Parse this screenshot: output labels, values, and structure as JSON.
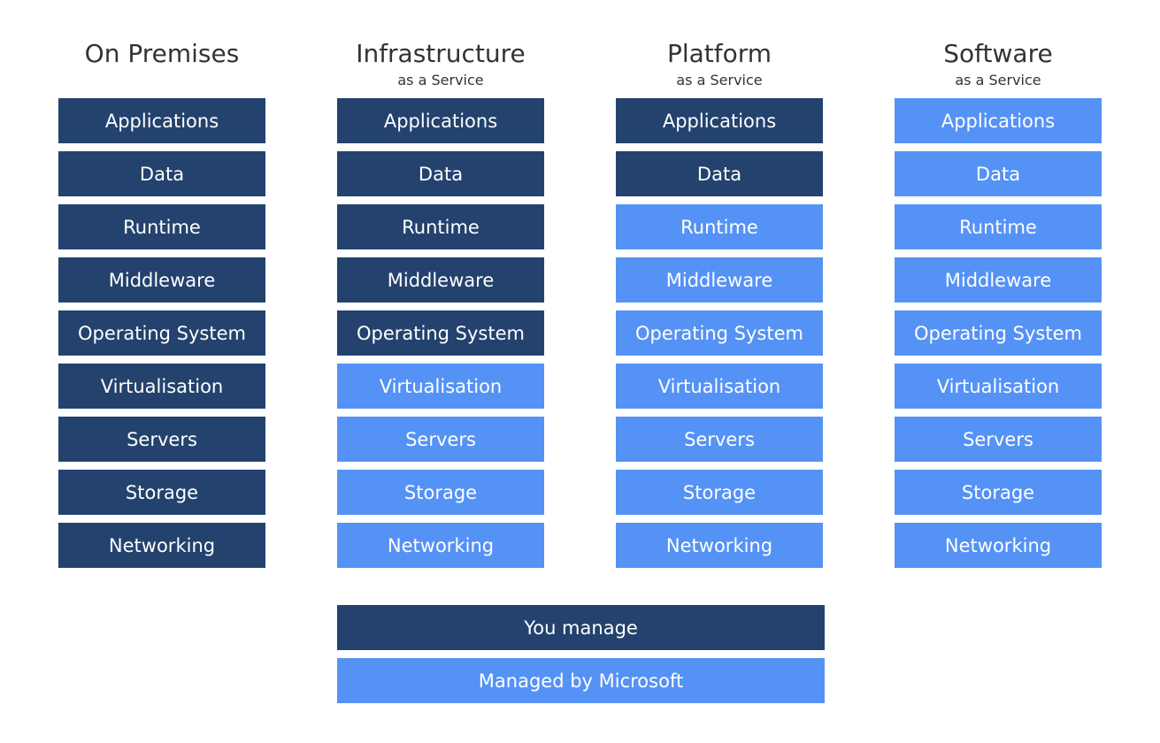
{
  "colors": {
    "you_manage": "#24426E",
    "managed_by_provider": "#5592F5"
  },
  "columns": [
    {
      "title": "On Premises",
      "subtitle": "",
      "layers": [
        {
          "label": "Applications",
          "managed_by": "you"
        },
        {
          "label": "Data",
          "managed_by": "you"
        },
        {
          "label": "Runtime",
          "managed_by": "you"
        },
        {
          "label": "Middleware",
          "managed_by": "you"
        },
        {
          "label": "Operating System",
          "managed_by": "you"
        },
        {
          "label": "Virtualisation",
          "managed_by": "you"
        },
        {
          "label": "Servers",
          "managed_by": "you"
        },
        {
          "label": "Storage",
          "managed_by": "you"
        },
        {
          "label": "Networking",
          "managed_by": "you"
        }
      ]
    },
    {
      "title": "Infrastructure",
      "subtitle": "as a Service",
      "layers": [
        {
          "label": "Applications",
          "managed_by": "you"
        },
        {
          "label": "Data",
          "managed_by": "you"
        },
        {
          "label": "Runtime",
          "managed_by": "you"
        },
        {
          "label": "Middleware",
          "managed_by": "you"
        },
        {
          "label": "Operating System",
          "managed_by": "you"
        },
        {
          "label": "Virtualisation",
          "managed_by": "microsoft"
        },
        {
          "label": "Servers",
          "managed_by": "microsoft"
        },
        {
          "label": "Storage",
          "managed_by": "microsoft"
        },
        {
          "label": "Networking",
          "managed_by": "microsoft"
        }
      ]
    },
    {
      "title": "Platform",
      "subtitle": "as a Service",
      "layers": [
        {
          "label": "Applications",
          "managed_by": "you"
        },
        {
          "label": "Data",
          "managed_by": "you"
        },
        {
          "label": "Runtime",
          "managed_by": "microsoft"
        },
        {
          "label": "Middleware",
          "managed_by": "microsoft"
        },
        {
          "label": "Operating System",
          "managed_by": "microsoft"
        },
        {
          "label": "Virtualisation",
          "managed_by": "microsoft"
        },
        {
          "label": "Servers",
          "managed_by": "microsoft"
        },
        {
          "label": "Storage",
          "managed_by": "microsoft"
        },
        {
          "label": "Networking",
          "managed_by": "microsoft"
        }
      ]
    },
    {
      "title": "Software",
      "subtitle": "as a Service",
      "layers": [
        {
          "label": "Applications",
          "managed_by": "microsoft"
        },
        {
          "label": "Data",
          "managed_by": "microsoft"
        },
        {
          "label": "Runtime",
          "managed_by": "microsoft"
        },
        {
          "label": "Middleware",
          "managed_by": "microsoft"
        },
        {
          "label": "Operating System",
          "managed_by": "microsoft"
        },
        {
          "label": "Virtualisation",
          "managed_by": "microsoft"
        },
        {
          "label": "Servers",
          "managed_by": "microsoft"
        },
        {
          "label": "Storage",
          "managed_by": "microsoft"
        },
        {
          "label": "Networking",
          "managed_by": "microsoft"
        }
      ]
    }
  ],
  "legend": {
    "you_manage": "You manage",
    "managed_by_microsoft": "Managed by Microsoft"
  }
}
